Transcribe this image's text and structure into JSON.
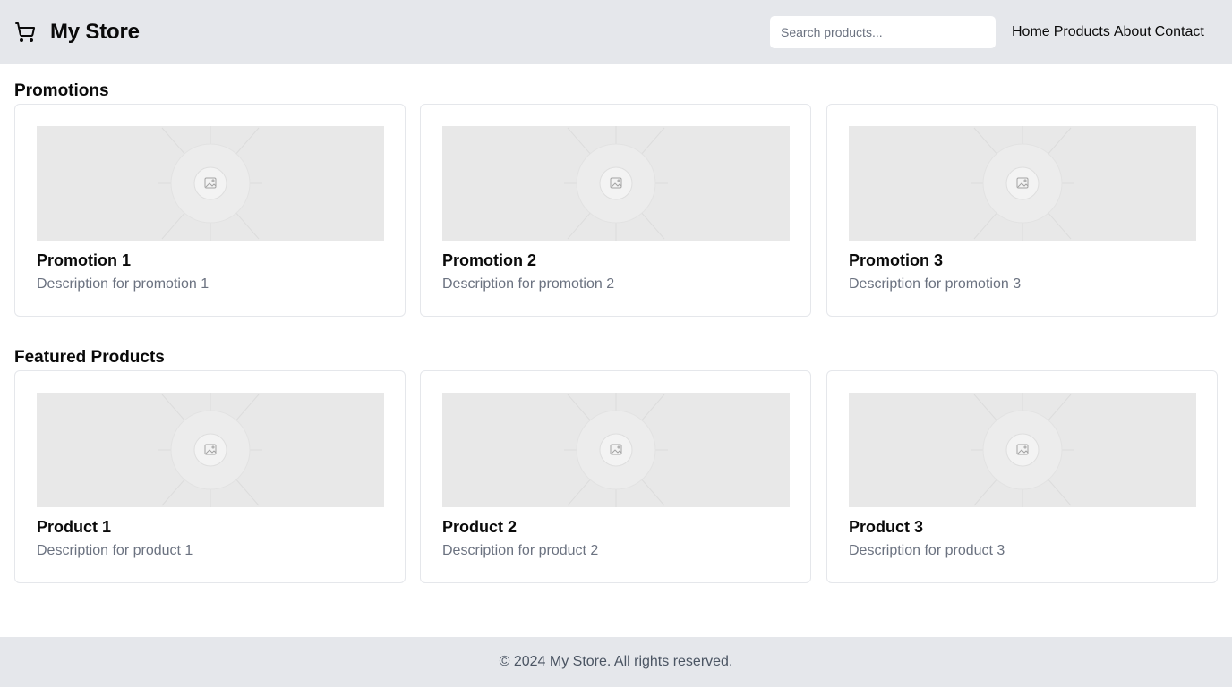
{
  "header": {
    "title": "My Store",
    "search_placeholder": "Search products...",
    "nav": [
      "Home",
      "Products",
      "About",
      "Contact"
    ]
  },
  "promotions": {
    "title": "Promotions",
    "items": [
      {
        "name": "Promotion 1",
        "description": "Description for promotion 1"
      },
      {
        "name": "Promotion 2",
        "description": "Description for promotion 2"
      },
      {
        "name": "Promotion 3",
        "description": "Description for promotion 3"
      }
    ]
  },
  "featured": {
    "title": "Featured Products",
    "items": [
      {
        "name": "Product 1",
        "description": "Description for product 1"
      },
      {
        "name": "Product 2",
        "description": "Description for product 2"
      },
      {
        "name": "Product 3",
        "description": "Description for product 3"
      }
    ]
  },
  "footer": {
    "text": "© 2024 My Store. All rights reserved."
  },
  "colors": {
    "header_bg": "#e5e7eb",
    "footer_bg": "#e5e7eb",
    "card_border": "#e5e7eb",
    "placeholder_bg": "#e8e8e8",
    "muted_text": "#6b7280"
  },
  "icons": {
    "brand": "cart-icon",
    "card_image": "image-placeholder-icon"
  }
}
